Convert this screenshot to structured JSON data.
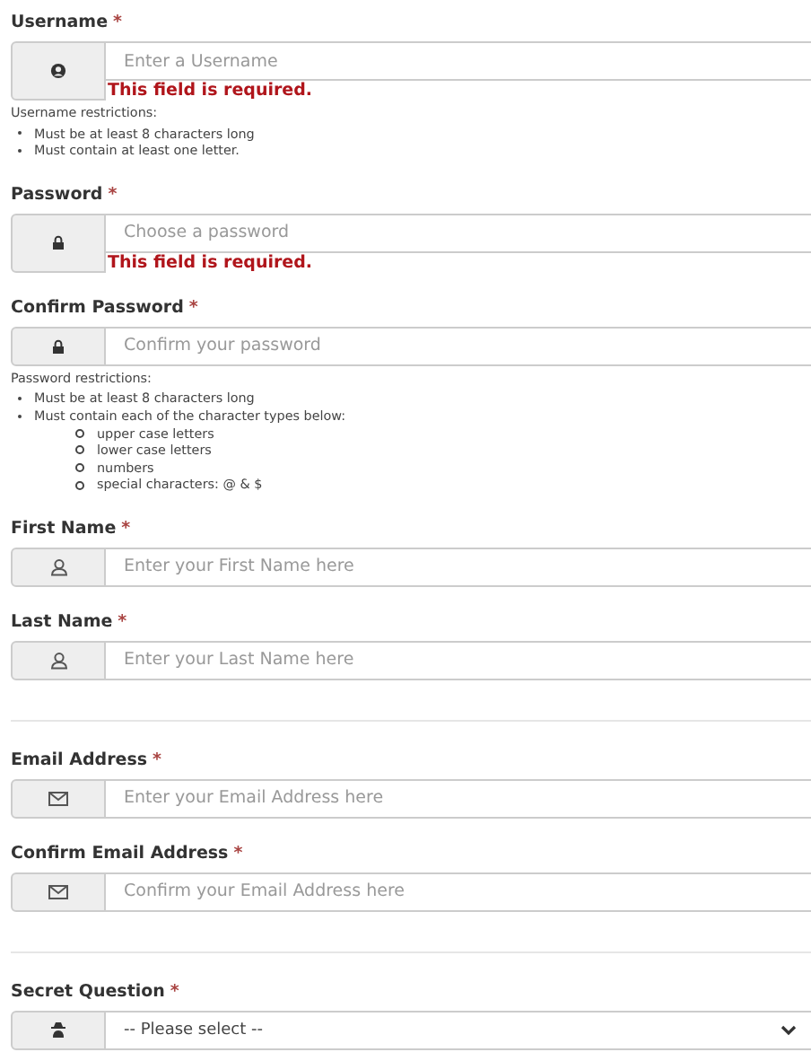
{
  "sections": [
    {
      "fields": [
        {
          "label": "Username",
          "required_mark": "*",
          "kind": "input",
          "placeholder": "Enter a Username",
          "error": "This field is required.",
          "restrictions": {
            "title": "Username restrictions:",
            "items": [
              {
                "text": "Must be at least 8 characters long"
              },
              {
                "text": "Must contain at least one letter."
              }
            ]
          }
        },
        {
          "label": "Password",
          "required_mark": "*",
          "kind": "input",
          "placeholder": "Choose a password",
          "error": "This field is required."
        },
        {
          "label": "Confirm Password",
          "required_mark": "*",
          "kind": "input",
          "placeholder": "Confirm your password",
          "restrictions": {
            "title": "Password restrictions:",
            "items": [
              {
                "text": "Must be at least 8 characters long"
              },
              {
                "text": "Must contain each of the character types below:",
                "children": [
                  {
                    "text": "upper case letters"
                  },
                  {
                    "text": "lower case letters"
                  },
                  {
                    "text": "numbers"
                  },
                  {
                    "text": "special characters: @ & $"
                  }
                ]
              }
            ]
          }
        },
        {
          "label": "First Name",
          "required_mark": "*",
          "kind": "input",
          "placeholder": "Enter your First Name here"
        },
        {
          "label": "Last Name",
          "required_mark": "*",
          "kind": "input",
          "placeholder": "Enter your Last Name here"
        }
      ]
    },
    {
      "fields": [
        {
          "label": "Email Address",
          "required_mark": "*",
          "kind": "input",
          "placeholder": "Enter your Email Address here"
        },
        {
          "label": "Confirm Email Address",
          "required_mark": "*",
          "kind": "input",
          "placeholder": "Confirm your Email Address here"
        }
      ]
    },
    {
      "fields": [
        {
          "label": "Secret Question",
          "required_mark": "*",
          "kind": "select",
          "value": "-- Please select --"
        }
      ]
    }
  ]
}
